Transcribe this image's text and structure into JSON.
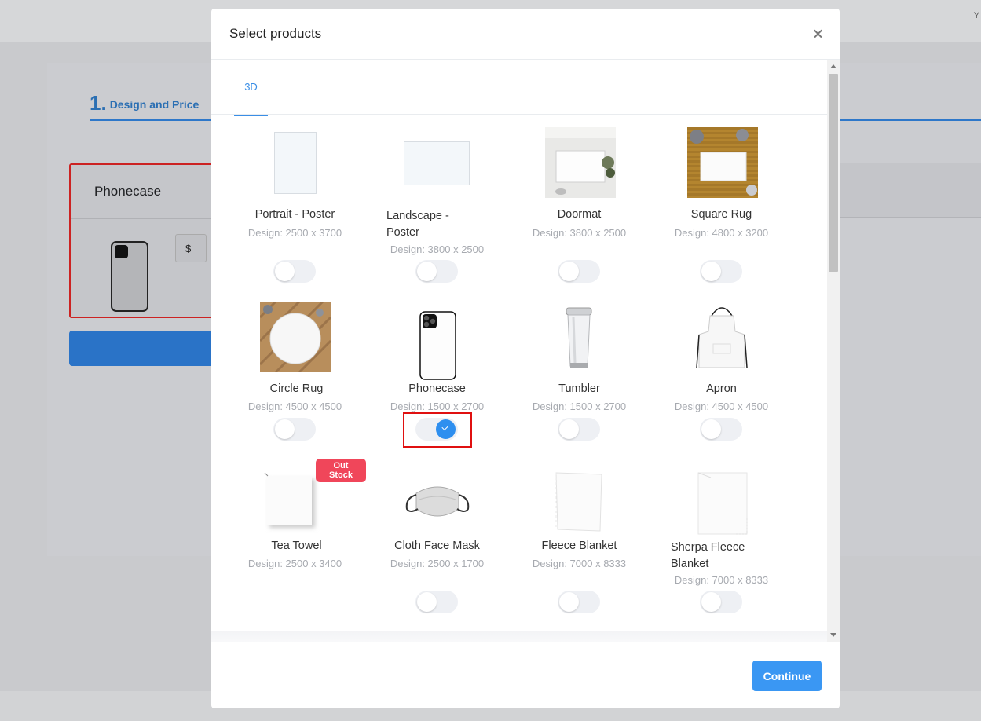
{
  "background": {
    "step_number": "1.",
    "step_label": "Design and Price",
    "product_title": "Phonecase",
    "currency": "$"
  },
  "modal": {
    "title": "Select products",
    "close_icon": "close-icon",
    "tabs": [
      {
        "label": "3D",
        "active": true
      }
    ],
    "products": [
      {
        "name": "Portrait - Poster",
        "design": "Design: 2500 x 3700",
        "selected": false
      },
      {
        "name": "Landscape - Poster",
        "design": "Design: 3800 x 2500",
        "selected": false
      },
      {
        "name": "Doormat",
        "design": "Design: 3800 x 2500",
        "selected": false
      },
      {
        "name": "Square Rug",
        "design": "Design: 4800 x 3200",
        "selected": false
      },
      {
        "name": "Circle Rug",
        "design": "Design: 4500 x 4500",
        "selected": false
      },
      {
        "name": "Phonecase",
        "design": "Design: 1500 x 2700",
        "selected": true
      },
      {
        "name": "Tumbler",
        "design": "Design: 1500 x 2700",
        "selected": false
      },
      {
        "name": "Apron",
        "design": "Design: 4500 x 4500",
        "selected": false
      },
      {
        "name": "Tea Towel",
        "design": "Design: 2500 x 3400",
        "badge": "Out Stock",
        "selected": false
      },
      {
        "name": "Cloth Face Mask",
        "design": "Design: 2500 x 1700",
        "selected": false
      },
      {
        "name": "Fleece Blanket",
        "design": "Design: 7000 x 8333",
        "selected": false
      },
      {
        "name": "Sherpa Fleece Blanket",
        "design": "Design: 7000 x 8333",
        "selected": false
      }
    ],
    "continue_label": "Continue"
  },
  "colors": {
    "accent": "#3a97f3",
    "toggle_on": "#2e8fef",
    "badge": "#f0465a",
    "highlight": "#e01010"
  }
}
